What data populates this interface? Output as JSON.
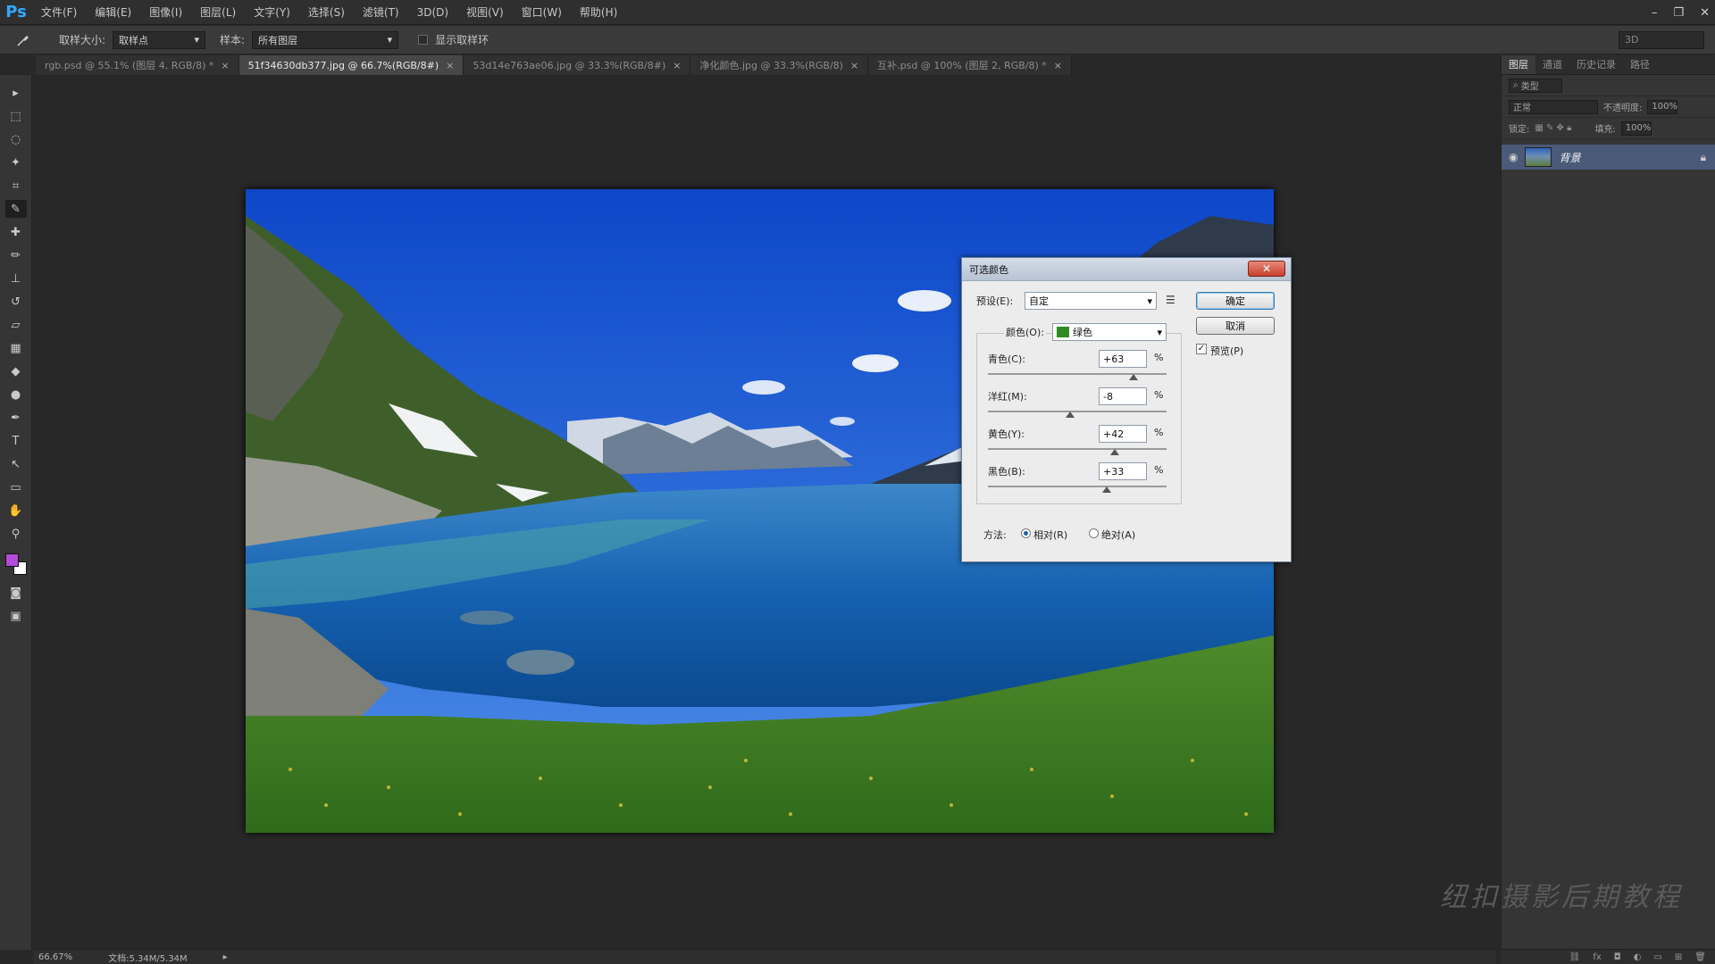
{
  "app": {
    "logo": "Ps"
  },
  "menu": [
    "文件(F)",
    "编辑(E)",
    "图像(I)",
    "图层(L)",
    "文字(Y)",
    "选择(S)",
    "滤镜(T)",
    "3D(D)",
    "视图(V)",
    "窗口(W)",
    "帮助(H)"
  ],
  "window_controls": {
    "minimize": "–",
    "restore": "❐",
    "close": "✕"
  },
  "options_bar": {
    "sample_size_label": "取样大小:",
    "sample_size_value": "取样点",
    "sample_label": "样本:",
    "sample_value": "所有图层",
    "show_ring_label": "显示取样环",
    "right_value": "3D"
  },
  "tabs": [
    {
      "label": "rgb.psd @ 55.1% (图层 4, RGB/8) *",
      "active": false
    },
    {
      "label": "51f34630db377.jpg @ 66.7%(RGB/8#)",
      "active": true
    },
    {
      "label": "53d14e763ae06.jpg @ 33.3%(RGB/8#)",
      "active": false
    },
    {
      "label": "净化颜色.jpg @ 33.3%(RGB/8)",
      "active": false
    },
    {
      "label": "互补.psd @ 100% (图层 2, RGB/8) *",
      "active": false
    }
  ],
  "right_panel": {
    "tabs": [
      "图层",
      "通道",
      "历史记录",
      "路径"
    ],
    "kind_label": "类型",
    "blend_mode": "正常",
    "opacity_label": "不透明度:",
    "opacity_value": "100%",
    "lock_label": "锁定:",
    "fill_label": "填充:",
    "fill_value": "100%",
    "layer_name": "背景"
  },
  "status": {
    "zoom": "66.67%",
    "doc": "文档:5.34M/5.34M"
  },
  "watermark": "纽扣摄影后期教程",
  "dialog": {
    "title": "可选颜色",
    "close": "✕",
    "preset_label": "预设(E):",
    "preset_value": "自定",
    "ok_label": "确定",
    "cancel_label": "取消",
    "preview_label": "预览(P)",
    "colors_label": "颜色(O):",
    "colors_value": "绿色",
    "colors_swatch": "#2e8b1f",
    "sliders": [
      {
        "label": "青色(C):",
        "value": "+63",
        "unit": "%",
        "fraction": 0.815
      },
      {
        "label": "洋红(M):",
        "value": "-8",
        "unit": "%",
        "fraction": 0.46
      },
      {
        "label": "黄色(Y):",
        "value": "+42",
        "unit": "%",
        "fraction": 0.71
      },
      {
        "label": "黑色(B):",
        "value": "+33",
        "unit": "%",
        "fraction": 0.665
      }
    ],
    "method_label": "方法:",
    "relative_label": "相对(R)",
    "absolute_label": "绝对(A)"
  }
}
